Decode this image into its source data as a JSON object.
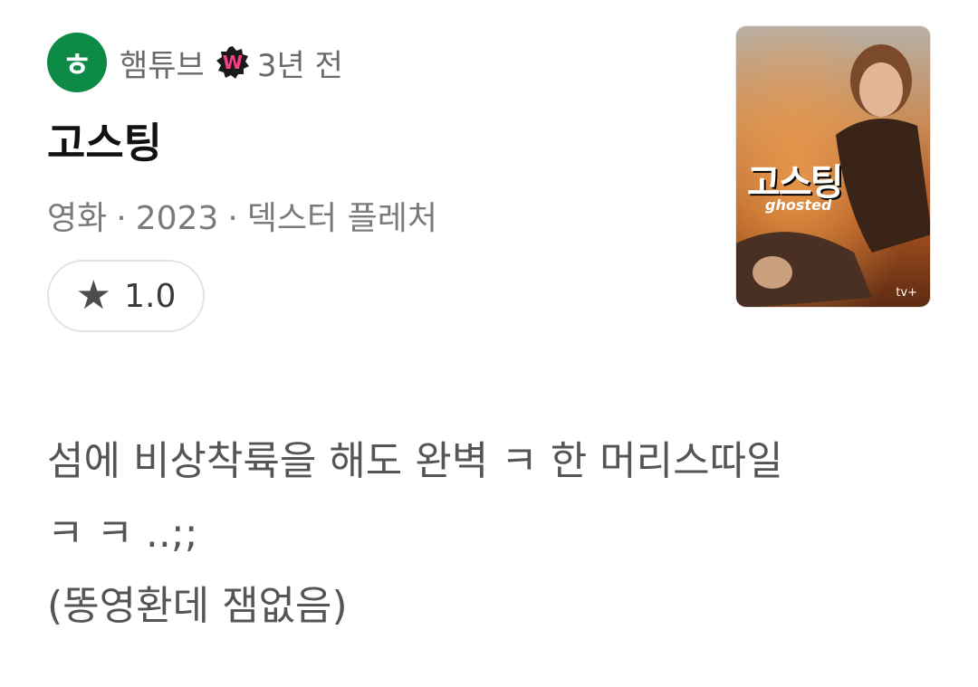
{
  "header": {
    "avatar_char": "ㅎ",
    "author": "햄튜브",
    "badge_letter": "W",
    "time": "3년 전"
  },
  "title": "고스팅",
  "meta": {
    "category": "영화",
    "year": "2023",
    "director": "덱스터 플레처",
    "separator": "·"
  },
  "rating": {
    "icon": "star-icon",
    "value": "1.0"
  },
  "poster": {
    "title": "고스팅",
    "subtitle": "ghosted",
    "logo": "tv+"
  },
  "review": {
    "lines": [
      "섬에 비상착륙을 해도 완벽 ㅋ 한 머리스따일",
      "ㅋ ㅋ ..;;",
      "(똥영환데 잼없음)"
    ]
  },
  "colors": {
    "avatar_bg": "#0e8a47",
    "badge_pink": "#ff3b8b",
    "text_dark": "#111111",
    "text_muted": "#7a7a7a"
  }
}
